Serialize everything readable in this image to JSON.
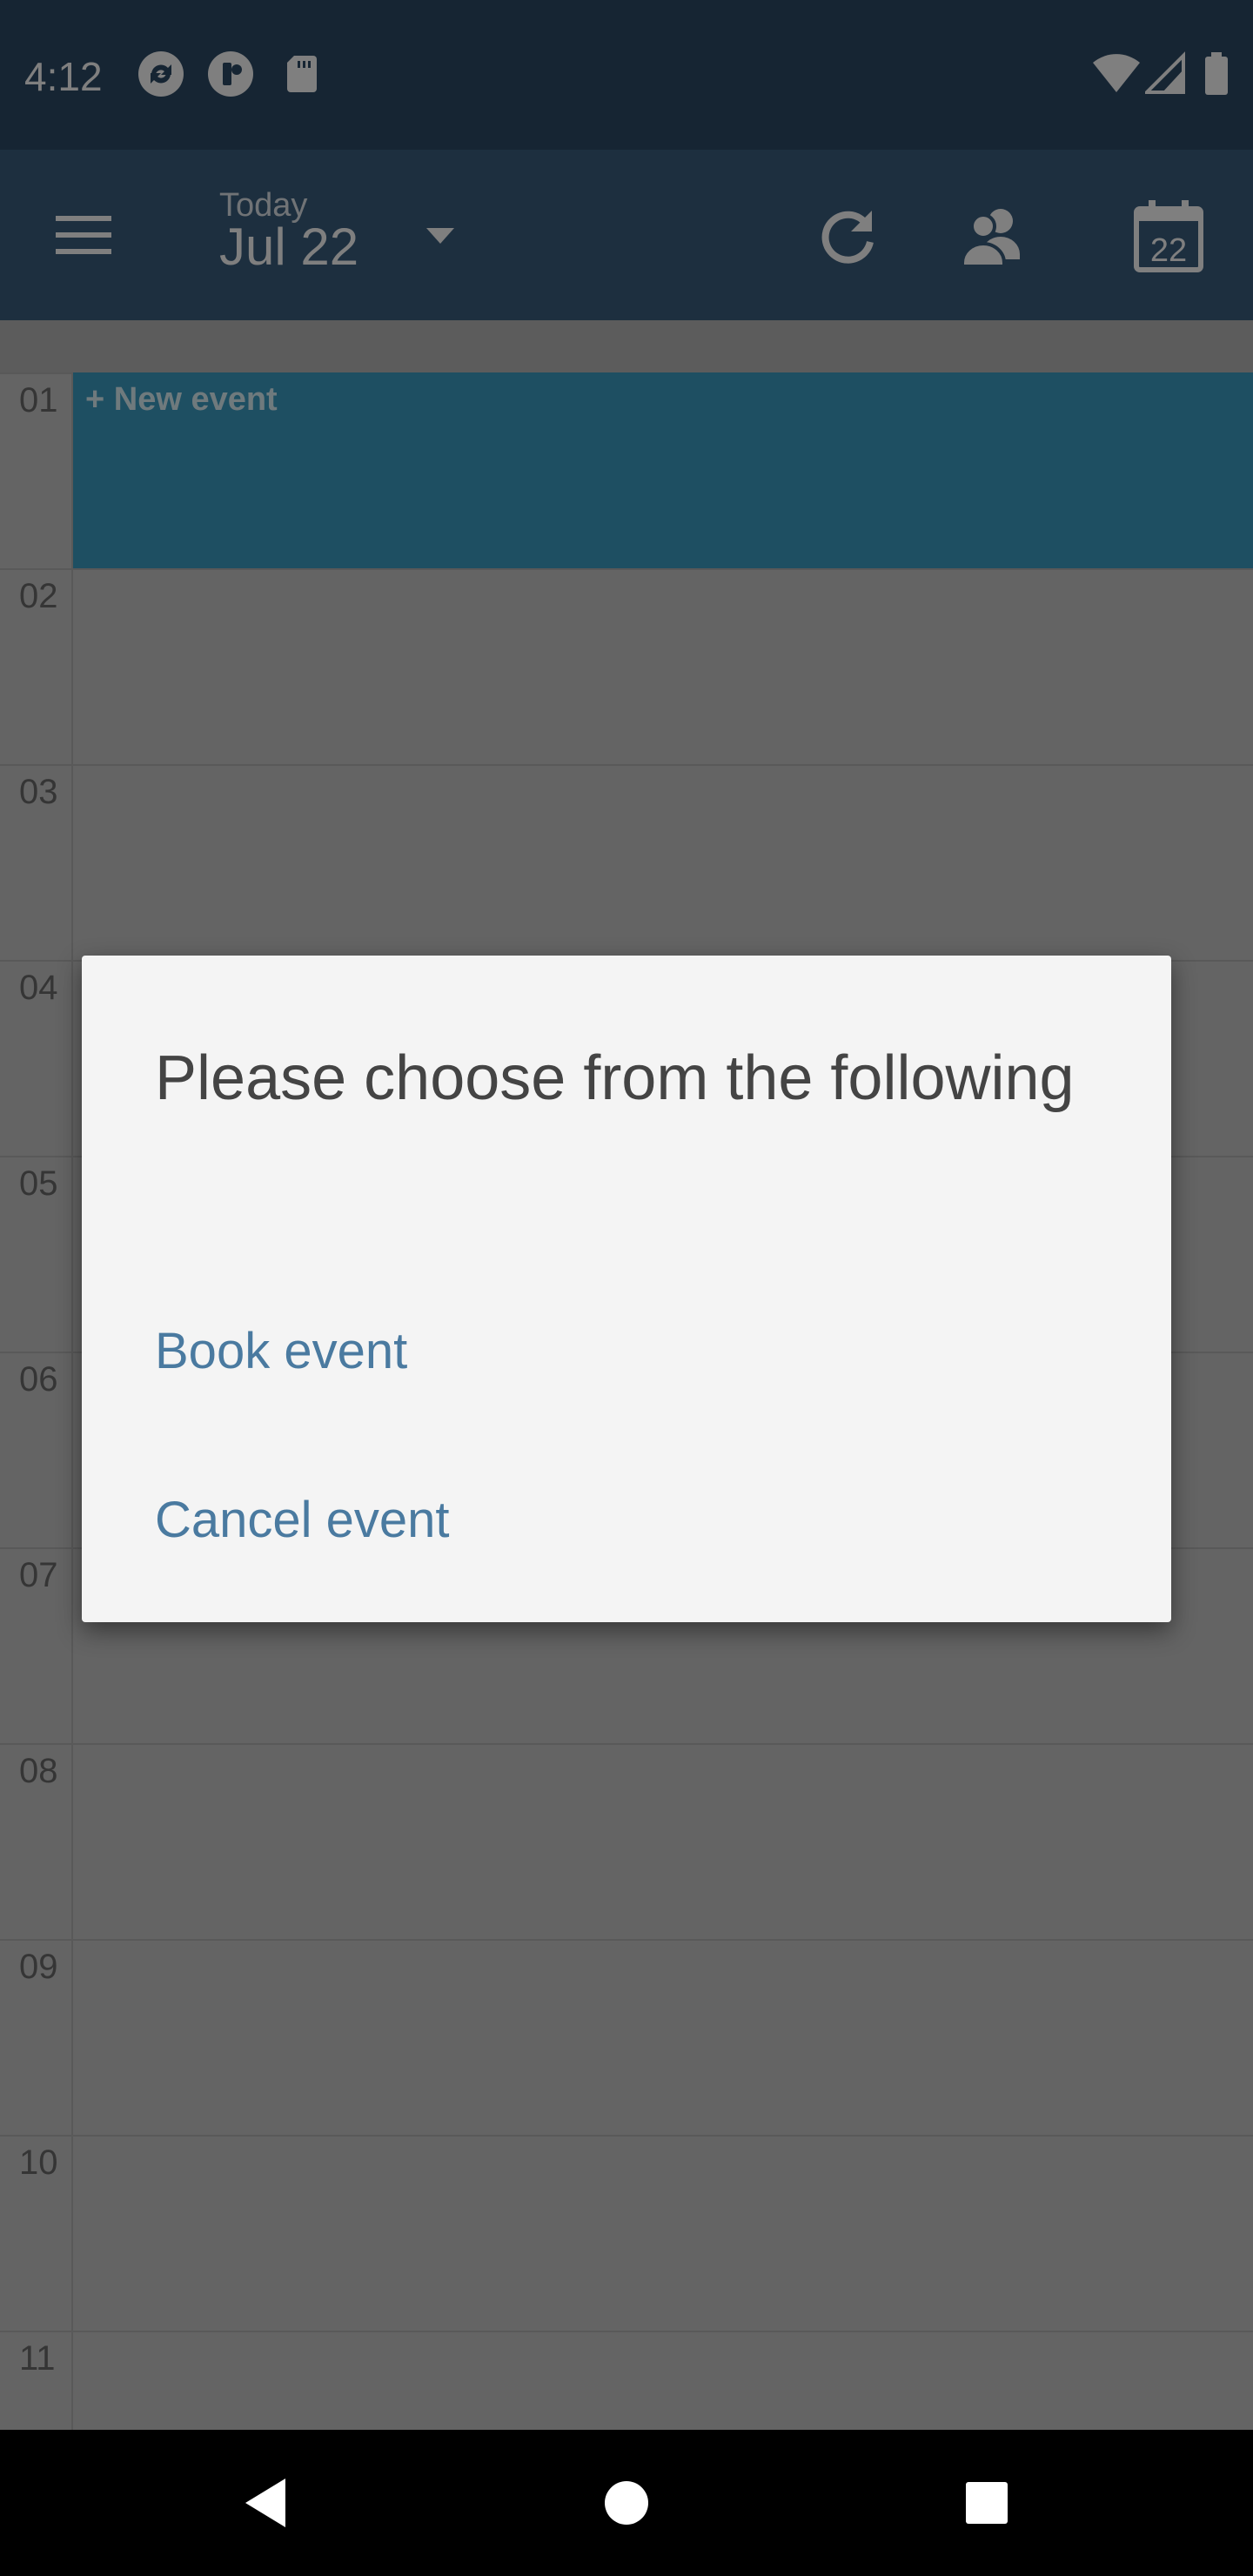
{
  "status_bar": {
    "time": "4:12",
    "left_icons": [
      "sync-icon",
      "app-icon",
      "sd-card-icon"
    ],
    "right_icons": [
      "wifi-icon",
      "signal-icon",
      "battery-icon"
    ]
  },
  "toolbar": {
    "today_label": "Today",
    "date_label": "Jul 22",
    "icons": [
      "menu-icon",
      "refresh-icon",
      "people-icon",
      "calendar-icon"
    ],
    "calendar_icon_number": "22"
  },
  "calendar": {
    "hours": [
      "01",
      "02",
      "03",
      "04",
      "05",
      "06",
      "07",
      "08",
      "09",
      "10",
      "11"
    ],
    "new_event_label": "+ New event"
  },
  "dialog": {
    "title": "Please choose from the following",
    "options": [
      "Book event",
      "Cancel event"
    ]
  },
  "colors": {
    "status_bar": "#2d4a66",
    "toolbar": "#3a5f7f",
    "new_event": "#3d9fc4",
    "dialog_link": "#4a7aa0"
  }
}
